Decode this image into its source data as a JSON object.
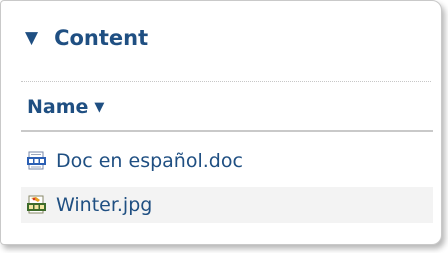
{
  "section": {
    "title": "Content",
    "toggle_icon": "triangle-down-icon"
  },
  "table": {
    "column_name": "Name",
    "sort_icon": "sort-descending-icon",
    "rows": [
      {
        "name": "Doc en español.doc",
        "icon": "doc-file-icon"
      },
      {
        "name": "Winter.jpg",
        "icon": "jpg-file-icon"
      }
    ]
  },
  "colors": {
    "link": "#1f4f82",
    "row_alt": "#f3f3f3"
  }
}
